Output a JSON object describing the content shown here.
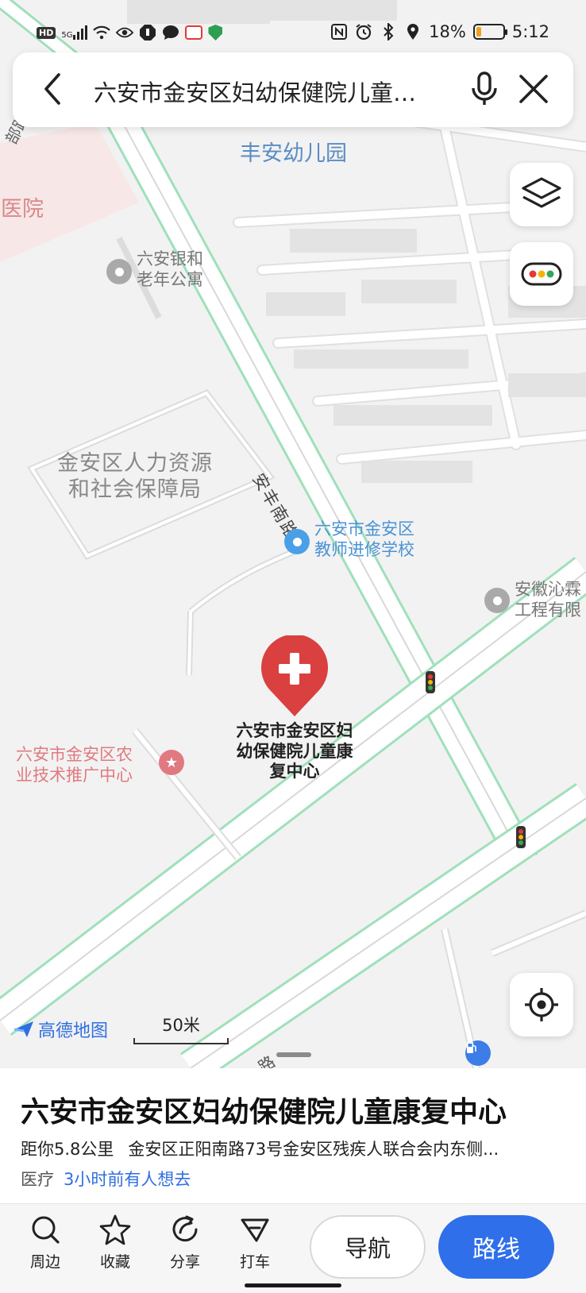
{
  "status_bar": {
    "left_badges": [
      "HD",
      "5G"
    ],
    "battery_percent": "18%",
    "battery_level": 0.18,
    "time": "5:12"
  },
  "search": {
    "query": "六安市金安区妇幼保健院儿童…",
    "back_icon": "chevron-left-icon",
    "mic_icon": "microphone-icon",
    "close_icon": "close-icon"
  },
  "map": {
    "labels": {
      "kindergarten": "丰安幼儿园",
      "hospital_partial": "职医院",
      "road_partial_top": "部路",
      "apartment_line1": "六安银和",
      "apartment_line2": "老年公寓",
      "hr_bureau_line1": "金安区人力资源",
      "hr_bureau_line2": "和社会保障局",
      "road_anfeng": "安丰南路",
      "school_line1": "六安市金安区",
      "school_line2": "教师进修学校",
      "company_line1": "安徽沁霖",
      "company_line2": "工程有限",
      "agri_line1": "六安市金安区农",
      "agri_line2": "业技术推广中心",
      "target_line1": "六安市金安区妇",
      "target_line2": "幼保健院儿童康",
      "target_line3": "复中心",
      "road_partial_bottom": "路"
    },
    "colors": {
      "road_edge": "#9fe0bb",
      "hospital_red": "#d9403f",
      "school_blue": "#4aa0e6",
      "poi_gray": "#a9a9a9",
      "agri_pink": "#e07a80"
    },
    "logo_text": "高德地图",
    "scale_text": "50米"
  },
  "place": {
    "title": "六安市金安区妇幼保健院儿童康复中心",
    "distance": "距你5.8公里",
    "address": "金安区正阳南路73号金安区残疾人联合会内东侧...",
    "category": "医疗",
    "popularity": "3小时前有人想去"
  },
  "actions": {
    "nearby": "周边",
    "favorite": "收藏",
    "share": "分享",
    "taxi": "打车",
    "navigate": "导航",
    "route": "路线"
  }
}
